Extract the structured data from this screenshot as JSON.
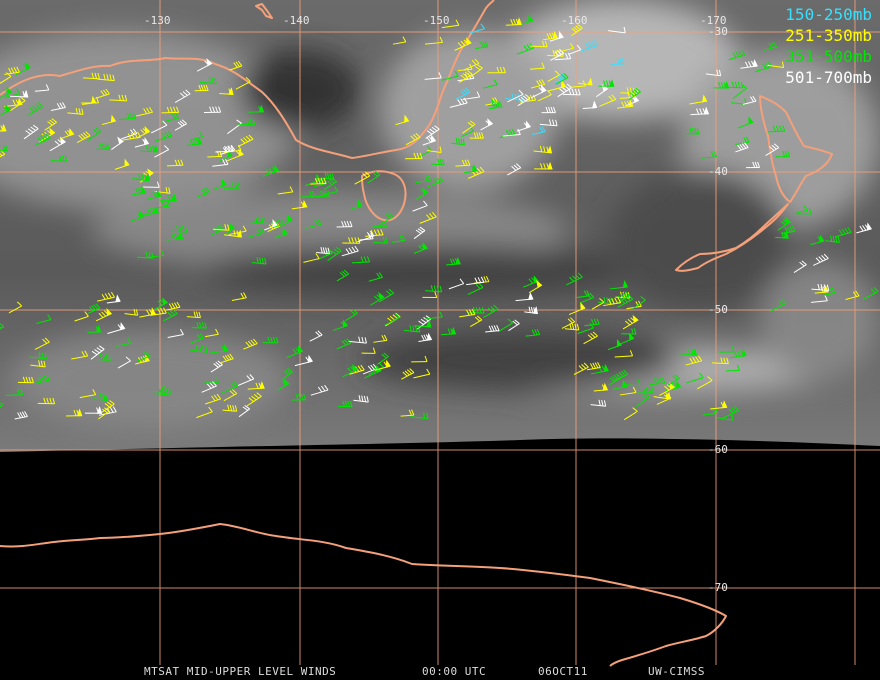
{
  "legend": [
    {
      "text": "150-250mb",
      "color": "#35e0ff"
    },
    {
      "text": "251-350mb",
      "color": "#ffff00"
    },
    {
      "text": "351-500mb",
      "color": "#00e600"
    },
    {
      "text": "501-700mb",
      "color": "#ffffff"
    }
  ],
  "longitude_labels": [
    "-130",
    "-140",
    "-150",
    "-160",
    "-170"
  ],
  "latitude_labels": [
    "-30",
    "-40",
    "-50",
    "-60",
    "-70"
  ],
  "footer": {
    "product": "MTSAT MID-UPPER LEVEL WINDS",
    "time": "00:00 UTC",
    "date": "06OCT11",
    "source": "UW-CIMSS"
  },
  "colors": {
    "coastline": "#f4a07a",
    "grid": "#f4a07a",
    "cloud_dark": "#3a3a3a",
    "cloud_light": "#bdbdbd"
  }
}
